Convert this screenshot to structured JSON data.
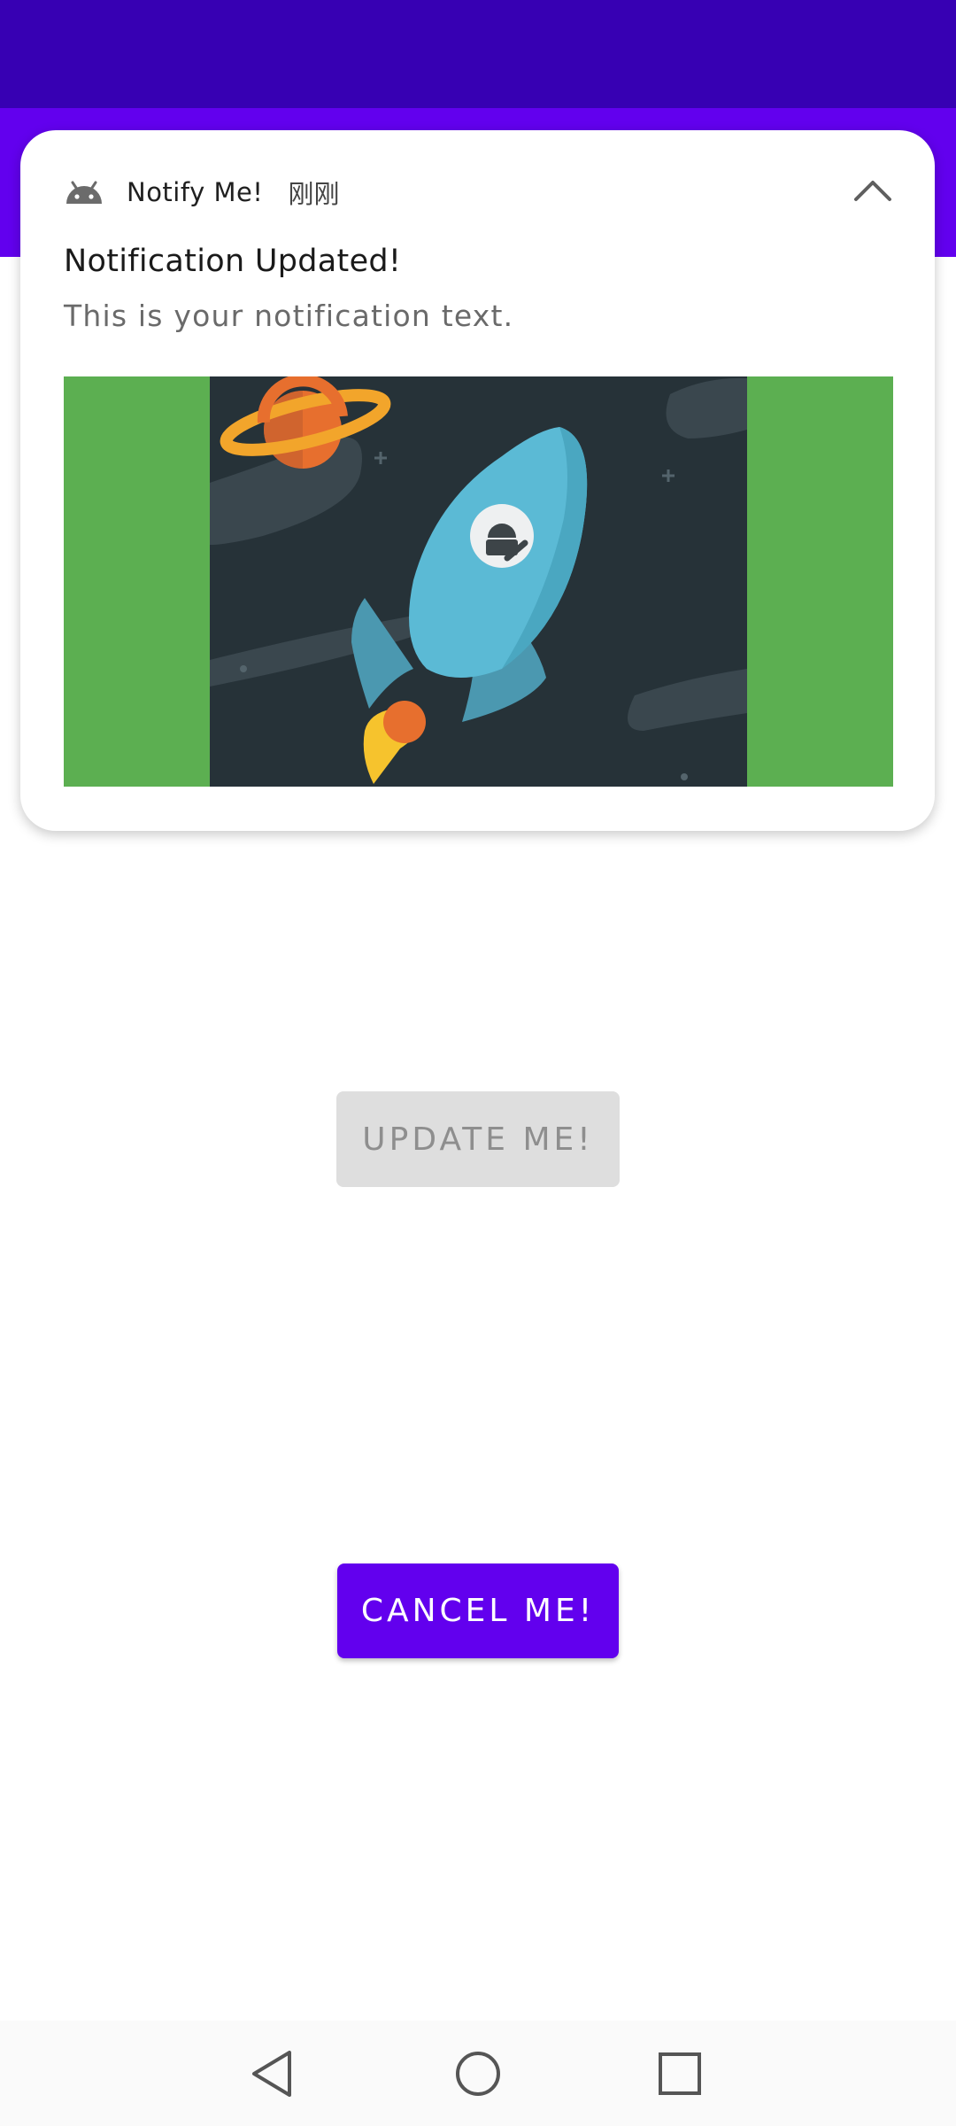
{
  "colors": {
    "status_bar": "#3700b3",
    "app_bar": "#6200ee",
    "accent": "#6200ee",
    "image_background": "#5caf51",
    "art_background": "#263238"
  },
  "notification": {
    "app_icon": "android-icon",
    "app_name": "Notify Me!",
    "time": "刚刚",
    "expand_icon": "chevron-up-icon",
    "title": "Notification Updated!",
    "text": "This is your notification text.",
    "image_icon": "rocket-illustration"
  },
  "main": {
    "update_button_label": "UPDATE ME!",
    "update_button_state": "disabled",
    "cancel_button_label": "CANCEL ME!"
  },
  "nav": {
    "back_icon": "back-triangle-icon",
    "home_icon": "home-circle-icon",
    "recents_icon": "recents-square-icon"
  }
}
